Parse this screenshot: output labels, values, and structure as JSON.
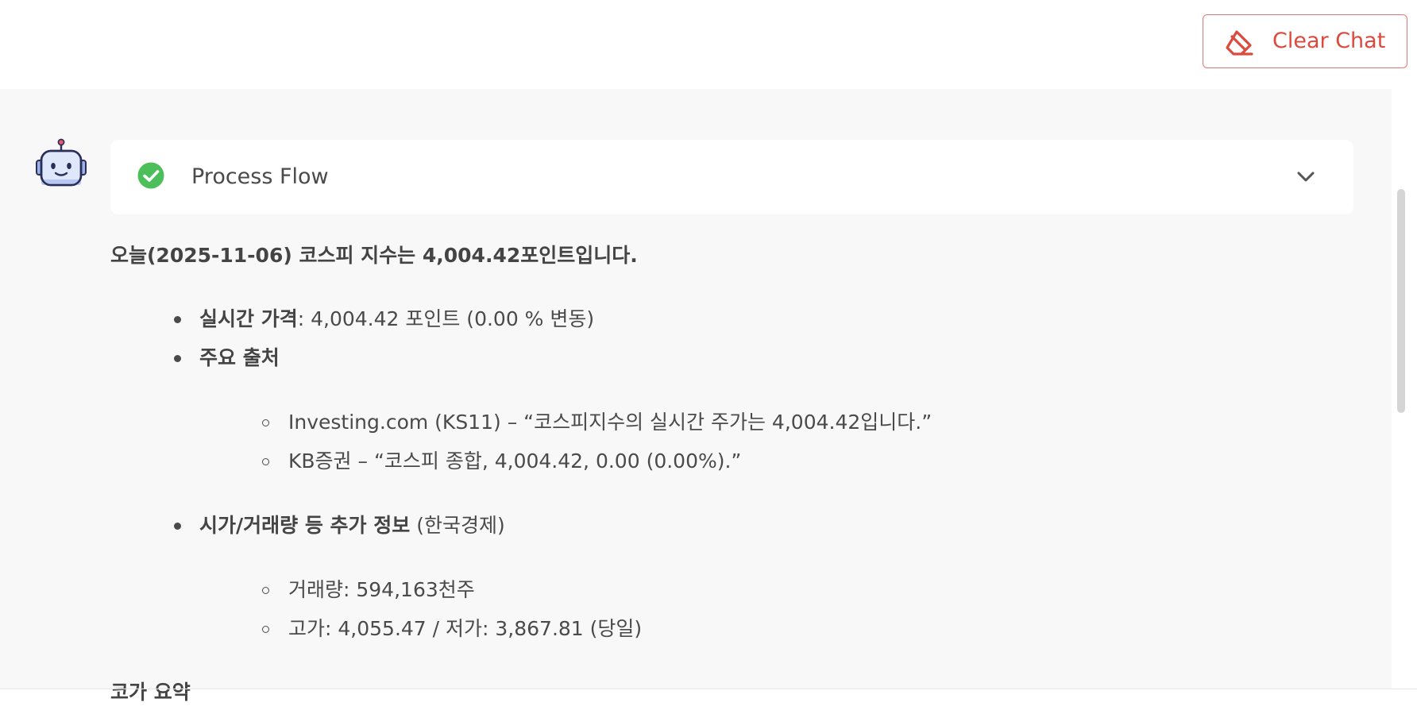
{
  "toolbar": {
    "clear_chat_label": "Clear Chat",
    "clear_chat_icon": "eraser-icon",
    "accent_color": "#db4a3d"
  },
  "process_flow": {
    "title": "Process Flow",
    "status_icon": "check-circle-icon",
    "status_color": "#4cbf5b",
    "toggle_icon": "chevron-down-icon"
  },
  "message": {
    "headline": "오늘(2025-11-06) 코스피 지수는 4,004.42포인트입니다.",
    "items": [
      {
        "label": "실시간 가격",
        "text": ": 4,004.42 포인트 (0.00 % 변동)"
      },
      {
        "label": "주요 출처",
        "text": "",
        "subitems": [
          "Investing.com (KS11) – “코스피지수의 실시간 주가는 4,004.42입니다.”",
          "KB증권 – “코스피 종합, 4,004.42, 0.00 (0.00%).”"
        ]
      },
      {
        "label": "시가/거래량 등 추가 정보",
        "text": " (한국경제)",
        "subitems": [
          "거래량: 594,163천주",
          "고가: 4,055.47 / 저가: 3,867.81 (당일)"
        ]
      }
    ],
    "cut_off_text": "코가 요약"
  }
}
